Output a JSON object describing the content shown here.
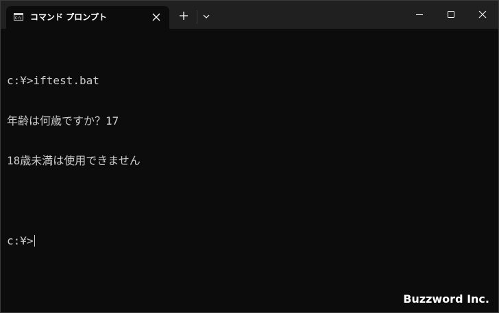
{
  "window": {
    "tab_title": "コマンド プロンプト"
  },
  "icons": {
    "tab_icon": "command-prompt-icon",
    "tab_close": "close-icon",
    "new_tab": "plus-icon",
    "dropdown": "chevron-down-icon",
    "minimize": "minimize-icon",
    "maximize": "maximize-icon",
    "close": "close-icon"
  },
  "terminal": {
    "lines": [
      "",
      "c:¥>iftest.bat",
      "年齢は何歳ですか？17",
      "18歳未満は使用できません",
      "",
      "c:¥>"
    ]
  },
  "watermark": "Buzzword Inc.",
  "colors": {
    "titlebar": "#202020",
    "tab": "#0c0c0c",
    "terminal_bg": "#0c0c0c",
    "terminal_text": "#cccccc"
  }
}
